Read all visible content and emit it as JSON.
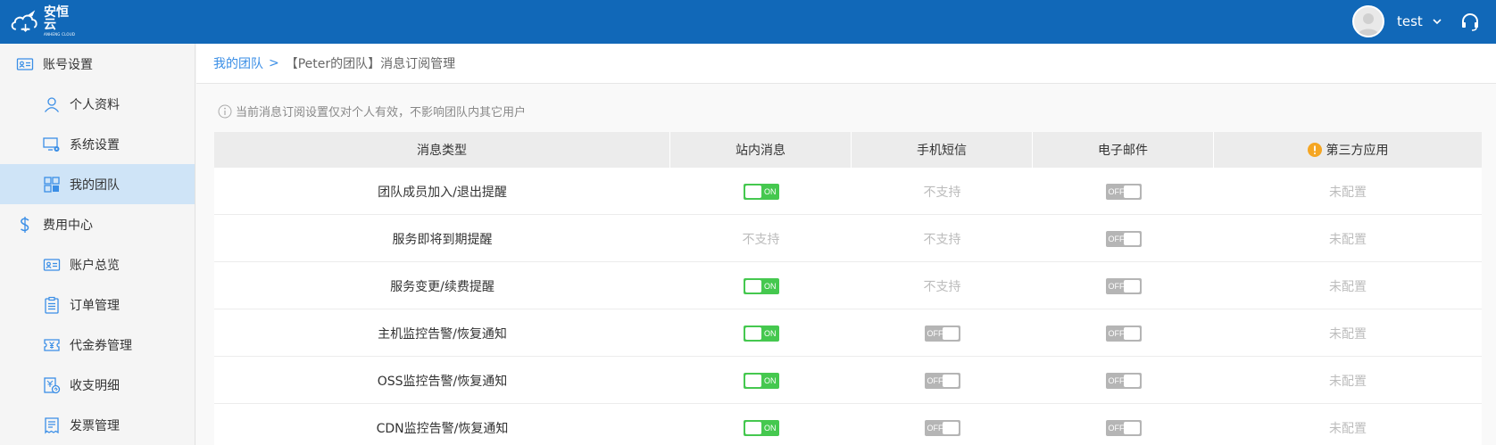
{
  "header": {
    "logo_main": "安恒云",
    "logo_sub": "ANHENG CLOUD",
    "username": "test"
  },
  "sidebar": {
    "items": [
      {
        "label": "账号设置",
        "level": "group",
        "icon": "id-card-icon"
      },
      {
        "label": "个人资料",
        "level": "child",
        "icon": "user-icon"
      },
      {
        "label": "系统设置",
        "level": "child",
        "icon": "monitor-gear-icon"
      },
      {
        "label": "我的团队",
        "level": "child",
        "icon": "grid-team-icon",
        "active": true
      },
      {
        "label": "费用中心",
        "level": "group",
        "icon": "dollar-icon"
      },
      {
        "label": "账户总览",
        "level": "child",
        "icon": "id-card-icon"
      },
      {
        "label": "订单管理",
        "level": "child",
        "icon": "clipboard-icon"
      },
      {
        "label": "代金券管理",
        "level": "child",
        "icon": "voucher-icon"
      },
      {
        "label": "收支明细",
        "level": "child",
        "icon": "yen-doc-icon"
      },
      {
        "label": "发票管理",
        "level": "child",
        "icon": "invoice-icon"
      }
    ]
  },
  "breadcrumb": {
    "link": "我的团队",
    "sep": ">",
    "current": "【Peter的团队】消息订阅管理"
  },
  "notice": "当前消息订阅设置仅对个人有效，不影响团队内其它用户",
  "table": {
    "columns": [
      "消息类型",
      "站内消息",
      "手机短信",
      "电子邮件",
      "第三方应用"
    ],
    "on_label": "ON",
    "off_label": "OFF",
    "rows": [
      {
        "type": "团队成员加入/退出提醒",
        "site": "on",
        "sms": "不支持",
        "email": "off",
        "third": "未配置"
      },
      {
        "type": "服务即将到期提醒",
        "site": "不支持",
        "sms": "不支持",
        "email": "off",
        "third": "未配置"
      },
      {
        "type": "服务变更/续费提醒",
        "site": "on",
        "sms": "不支持",
        "email": "off",
        "third": "未配置"
      },
      {
        "type": "主机监控告警/恢复通知",
        "site": "on",
        "sms": "off",
        "email": "off",
        "third": "未配置"
      },
      {
        "type": "OSS监控告警/恢复通知",
        "site": "on",
        "sms": "off",
        "email": "off",
        "third": "未配置"
      },
      {
        "type": "CDN监控告警/恢复通知",
        "site": "on",
        "sms": "off",
        "email": "off",
        "third": "未配置"
      }
    ]
  },
  "colors": {
    "header_bg": "#1168b8",
    "toggle_on": "#45c84f",
    "toggle_off": "#b5b5b5",
    "link": "#3a8ee6",
    "warning": "#f5a623"
  }
}
